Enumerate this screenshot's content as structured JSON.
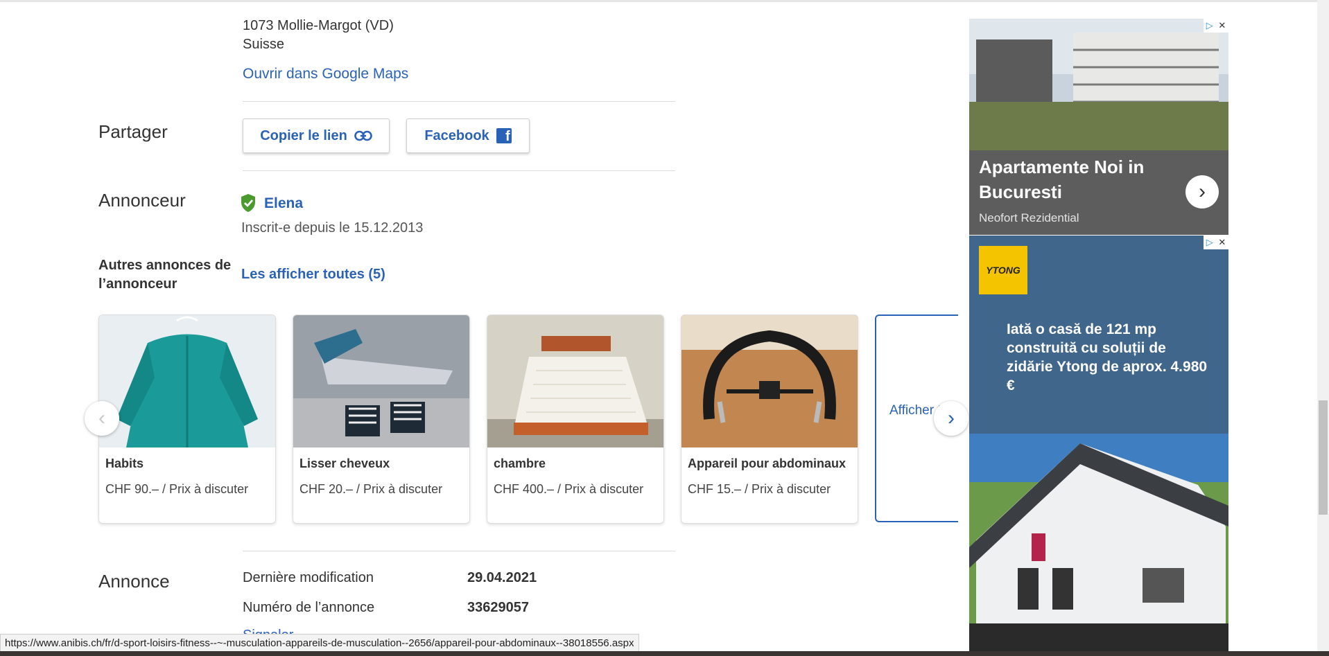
{
  "location": {
    "address": "1073 Mollie-Margot (VD)",
    "country": "Suisse",
    "maps_link": "Ouvrir dans Google Maps"
  },
  "share": {
    "title": "Partager",
    "copy_link": "Copier le lien",
    "facebook": "Facebook",
    "facebook_icon_letter": "f"
  },
  "advertiser": {
    "title": "Annonceur",
    "name": "Elena",
    "since": "Inscrit-e depuis le 15.12.2013",
    "other_ads_title": "Autres annonces de l’annonceur",
    "show_all": "Les afficher toutes (5)"
  },
  "listings": [
    {
      "title": "Habits",
      "price": "CHF 90.– / Prix à discuter"
    },
    {
      "title": "Lisser cheveux",
      "price": "CHF 20.– / Prix à discuter"
    },
    {
      "title": "chambre",
      "price": "CHF 400.– / Prix à discuter"
    },
    {
      "title": "Appareil pour abdominaux",
      "price": "CHF 15.– / Prix à discuter"
    }
  ],
  "show_more_card": "Afficher t",
  "carousel": {
    "prev_icon": "‹",
    "next_icon": "›"
  },
  "annonce": {
    "title": "Annonce",
    "rows": [
      {
        "label": "Dernière modification",
        "value": "29.04.2021"
      },
      {
        "label": "Numéro de l’annonce",
        "value": "33629057"
      }
    ],
    "partial_link": "Signaler"
  },
  "ads": {
    "ad1_headline": "Apartamente Noi in Bucuresti",
    "ad1_sponsor": "Neofort Rezidential",
    "ad2_brand": "YTONG",
    "ad2_text": "Iată o casă de 121 mp construită cu soluții de zidărie Ytong de aprox. 4.980 €"
  },
  "status_url": "https://www.anibis.ch/fr/d-sport-loisirs-fitness--~-musculation-appareils-de-musculation--2656/appareil-pour-abdominaux--38018556.aspx",
  "colors": {
    "link": "#2a62b8",
    "verified": "#4a9a2e"
  }
}
